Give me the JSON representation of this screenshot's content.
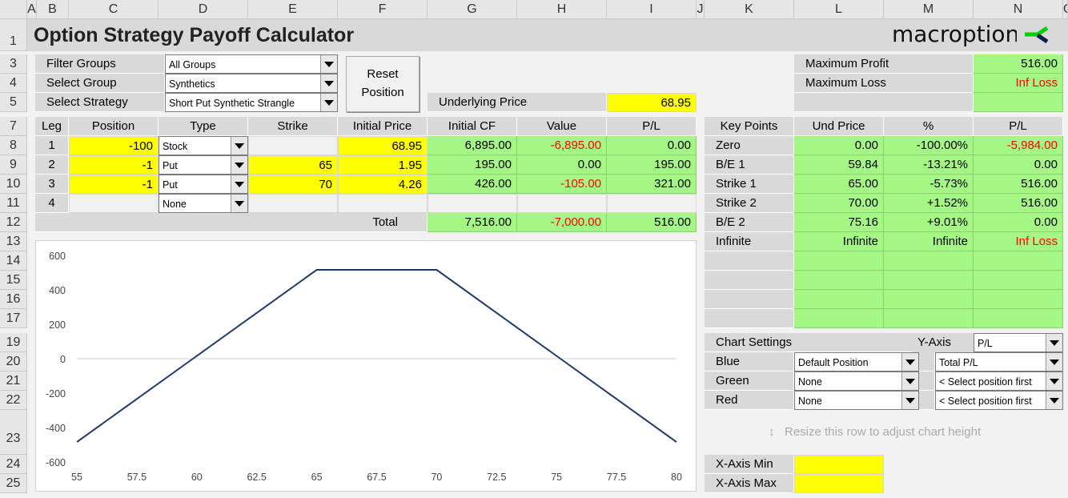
{
  "columns": [
    "A",
    "B",
    "C",
    "D",
    "E",
    "F",
    "G",
    "H",
    "I",
    "J",
    "K",
    "L",
    "M",
    "N",
    "O"
  ],
  "rows": [
    "1",
    "3",
    "4",
    "5",
    "7",
    "8",
    "9",
    "10",
    "11",
    "12",
    "13",
    "14",
    "15",
    "16",
    "17",
    "19",
    "20",
    "21",
    "22",
    "23",
    "24",
    "25"
  ],
  "title": "Option Strategy Payoff Calculator",
  "logo": {
    "text": "macroption",
    "colors": [
      "#00d000",
      "#0a1e50"
    ]
  },
  "selectors": {
    "filter_groups": {
      "label": "Filter Groups",
      "value": "All Groups"
    },
    "select_group": {
      "label": "Select Group",
      "value": "Synthetics"
    },
    "select_strategy": {
      "label": "Select Strategy",
      "value": "Short Put Synthetic Strangle"
    }
  },
  "reset_button": {
    "line1": "Reset",
    "line2": "Position"
  },
  "underlying": {
    "label": "Underlying Price",
    "value": "68.95"
  },
  "summary": {
    "max_profit_label": "Maximum Profit",
    "max_profit": "516.00",
    "max_loss_label": "Maximum Loss",
    "max_loss": "Inf Loss"
  },
  "legs": {
    "headers": [
      "Leg",
      "Position",
      "Type",
      "Strike",
      "Initial Price",
      "Initial CF",
      "Value",
      "P/L"
    ],
    "rows": [
      {
        "leg": "1",
        "position": "-100",
        "type": "Stock",
        "strike": "",
        "price": "68.95",
        "cf": "6,895.00",
        "value": "-6,895.00",
        "pl": "0.00"
      },
      {
        "leg": "2",
        "position": "-1",
        "type": "Put",
        "strike": "65",
        "price": "1.95",
        "cf": "195.00",
        "value": "0.00",
        "pl": "195.00"
      },
      {
        "leg": "3",
        "position": "-1",
        "type": "Put",
        "strike": "70",
        "price": "4.26",
        "cf": "426.00",
        "value": "-105.00",
        "pl": "321.00"
      },
      {
        "leg": "4",
        "position": "",
        "type": "None",
        "strike": "",
        "price": "",
        "cf": "",
        "value": "",
        "pl": ""
      }
    ],
    "total_label": "Total",
    "total_cf": "7,516.00",
    "total_value": "-7,000.00",
    "total_pl": "516.00"
  },
  "key_points": {
    "headers": [
      "Key Points",
      "Und Price",
      "%",
      "P/L"
    ],
    "rows": [
      {
        "name": "Zero",
        "price": "0.00",
        "pct": "-100.00%",
        "pl": "-5,984.00"
      },
      {
        "name": "B/E 1",
        "price": "59.84",
        "pct": "-13.21%",
        "pl": "0.00"
      },
      {
        "name": "Strike 1",
        "price": "65.00",
        "pct": "-5.73%",
        "pl": "516.00"
      },
      {
        "name": "Strike 2",
        "price": "70.00",
        "pct": "+1.52%",
        "pl": "516.00"
      },
      {
        "name": "B/E 2",
        "price": "75.16",
        "pct": "+9.01%",
        "pl": "0.00"
      },
      {
        "name": "Infinite",
        "price": "Infinite",
        "pct": "Infinite",
        "pl": "Inf Loss"
      }
    ]
  },
  "chart_settings": {
    "label": "Chart Settings",
    "y_axis_label": "Y-Axis",
    "y_axis_value": "P/L",
    "rows": [
      {
        "name": "Blue",
        "position": "Default Position",
        "series": "Total P/L"
      },
      {
        "name": "Green",
        "position": "None",
        "series": "< Select position first"
      },
      {
        "name": "Red",
        "position": "None",
        "series": "< Select position first"
      }
    ],
    "resize_hint": "Resize this row to adjust chart height",
    "x_min_label": "X-Axis Min",
    "x_min": "",
    "x_max_label": "X-Axis Max",
    "x_max": ""
  },
  "chart_data": {
    "type": "line",
    "title": "",
    "xlabel": "",
    "ylabel": "",
    "xlim": [
      55,
      80
    ],
    "ylim": [
      -600,
      600
    ],
    "grid": false,
    "xticks": [
      "55",
      "57.5",
      "60",
      "62.5",
      "65",
      "67.5",
      "70",
      "72.5",
      "75",
      "77.5",
      "80"
    ],
    "yticks": [
      "600",
      "400",
      "200",
      "0",
      "-200",
      "-400",
      "-600"
    ],
    "series": [
      {
        "color": "#1f3864",
        "x": [
          55,
          59.84,
          65,
          70,
          75.16,
          80
        ],
        "y": [
          -484,
          0,
          516,
          516,
          0,
          -484
        ]
      }
    ]
  }
}
